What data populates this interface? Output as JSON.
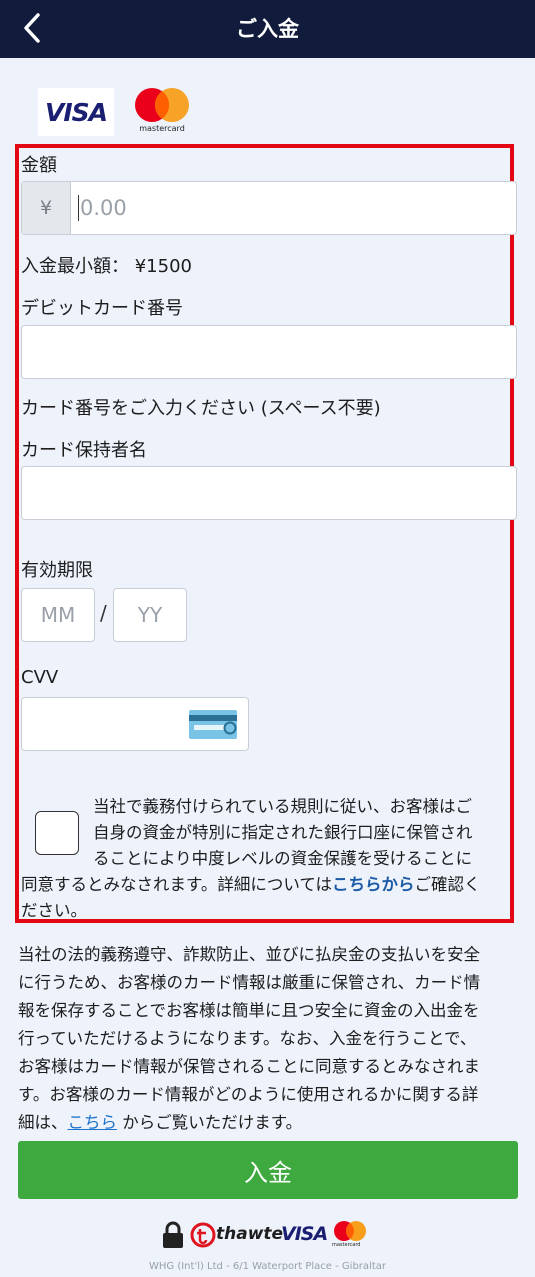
{
  "header": {
    "title": "ご入金",
    "back_icon": "chevron-left-icon"
  },
  "payment_logos": {
    "visa": "VISA",
    "mastercard": "mastercard"
  },
  "form": {
    "amount": {
      "label": "金額",
      "currency_symbol": "¥",
      "placeholder": "0.00",
      "value": ""
    },
    "min_deposit": "入金最小額： ¥1500",
    "card_number": {
      "label": "デビットカード番号",
      "value": "",
      "hint": "カード番号をご入力ください (スペース不要)"
    },
    "card_holder": {
      "label": "カード保持者名",
      "value": ""
    },
    "expiry": {
      "label": "有効期限",
      "month_placeholder": "MM",
      "separator": "/",
      "year_placeholder": "YY"
    },
    "cvv": {
      "label": "CVV",
      "value": "",
      "icon": "credit-card-icon"
    },
    "consent": {
      "checked": false,
      "line1": "当社で義務付けられている規則に従い、お客様はご",
      "line2": "自身の資金が特別に指定された銀行口座に保管され",
      "line3": "ることにより中度レベルの資金保護を受けることに",
      "line4_prefix": "同意するとみなされます。詳細については",
      "line4_link": "こちらから",
      "line4_suffix": "ご確認く",
      "line5": "ださい。"
    }
  },
  "info": {
    "line1": "当社の法的義務遵守、詐欺防止、並びに払戻金の支払いを安全",
    "line2": "に行うため、お客様のカード情報は厳重に保管され、カード情",
    "line3": "報を保存することでお客様は簡単に且つ安全に資金の入出金を",
    "line4": "行っていただけるようになります。なお、入金を行うことで、",
    "line5": "お客様はカード情報が保管されることに同意するとみなされま",
    "line6": "す。お客様のカード情報がどのように使用されるかに関する詳",
    "line7_prefix": "細は、",
    "line7_link": "こちら",
    "line7_suffix": " からご覧いただけます。"
  },
  "submit_label": "入金",
  "footer": {
    "logos": {
      "thawte": "thawte",
      "visa": "VISA",
      "mastercard": "mastercard"
    },
    "text": "WHG (Int'l) Ltd - 6/1 Waterport Place - Gibraltar"
  },
  "colors": {
    "header_bg": "#111c3d",
    "highlight_border": "#e30613",
    "button_bg": "#3ea93e",
    "link": "#1b5aa6"
  }
}
